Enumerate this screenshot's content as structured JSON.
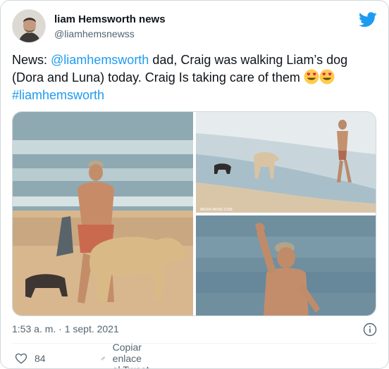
{
  "author": {
    "name": "liam Hemsworth news",
    "handle": "@liamhemsnewss"
  },
  "tweet": {
    "segments": [
      {
        "text": "News: ",
        "type": "text"
      },
      {
        "text": "@liamhemsworth",
        "type": "link"
      },
      {
        "text": " dad, Craig was walking Liam’s dog (Dora and Luna) today. Craig  Is taking care of them ",
        "type": "text"
      }
    ],
    "hashtag": "#liamhemsworth",
    "emoji": [
      "heart-eyes-emoji",
      "heart-eyes-emoji"
    ]
  },
  "media": {
    "photos": [
      {
        "name": "photo-beach-dogs-petting",
        "credit": ""
      },
      {
        "name": "photo-beach-dogs-walking",
        "credit": "MEDIA-MODE.COM"
      },
      {
        "name": "photo-waving",
        "credit": ""
      }
    ]
  },
  "timestamp": "1:53 a. m. · 1 sept. 2021",
  "actions": {
    "like_count": "84",
    "copy_link_label": "Copiar enlace al Tweet"
  },
  "icons": {
    "brand": "twitter-bird-icon",
    "info": "info-icon",
    "like": "heart-icon",
    "link": "link-icon"
  },
  "colors": {
    "accent": "#1d9bf0",
    "text": "#0f1419",
    "secondary": "#536471",
    "border": "#cfd9de"
  }
}
